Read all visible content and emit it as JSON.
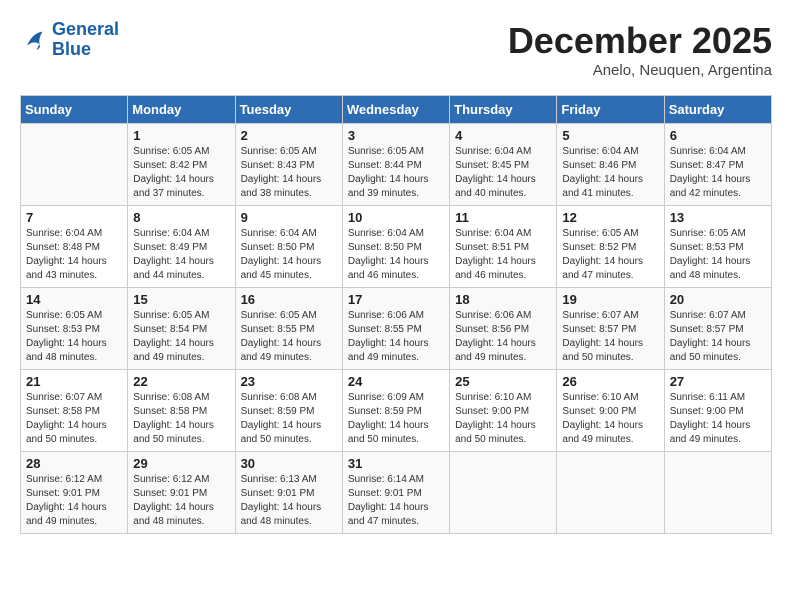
{
  "header": {
    "logo_line1": "General",
    "logo_line2": "Blue",
    "month": "December 2025",
    "location": "Anelo, Neuquen, Argentina"
  },
  "weekdays": [
    "Sunday",
    "Monday",
    "Tuesday",
    "Wednesday",
    "Thursday",
    "Friday",
    "Saturday"
  ],
  "weeks": [
    [
      {
        "day": "",
        "info": ""
      },
      {
        "day": "1",
        "info": "Sunrise: 6:05 AM\nSunset: 8:42 PM\nDaylight: 14 hours\nand 37 minutes."
      },
      {
        "day": "2",
        "info": "Sunrise: 6:05 AM\nSunset: 8:43 PM\nDaylight: 14 hours\nand 38 minutes."
      },
      {
        "day": "3",
        "info": "Sunrise: 6:05 AM\nSunset: 8:44 PM\nDaylight: 14 hours\nand 39 minutes."
      },
      {
        "day": "4",
        "info": "Sunrise: 6:04 AM\nSunset: 8:45 PM\nDaylight: 14 hours\nand 40 minutes."
      },
      {
        "day": "5",
        "info": "Sunrise: 6:04 AM\nSunset: 8:46 PM\nDaylight: 14 hours\nand 41 minutes."
      },
      {
        "day": "6",
        "info": "Sunrise: 6:04 AM\nSunset: 8:47 PM\nDaylight: 14 hours\nand 42 minutes."
      }
    ],
    [
      {
        "day": "7",
        "info": "Sunrise: 6:04 AM\nSunset: 8:48 PM\nDaylight: 14 hours\nand 43 minutes."
      },
      {
        "day": "8",
        "info": "Sunrise: 6:04 AM\nSunset: 8:49 PM\nDaylight: 14 hours\nand 44 minutes."
      },
      {
        "day": "9",
        "info": "Sunrise: 6:04 AM\nSunset: 8:50 PM\nDaylight: 14 hours\nand 45 minutes."
      },
      {
        "day": "10",
        "info": "Sunrise: 6:04 AM\nSunset: 8:50 PM\nDaylight: 14 hours\nand 46 minutes."
      },
      {
        "day": "11",
        "info": "Sunrise: 6:04 AM\nSunset: 8:51 PM\nDaylight: 14 hours\nand 46 minutes."
      },
      {
        "day": "12",
        "info": "Sunrise: 6:05 AM\nSunset: 8:52 PM\nDaylight: 14 hours\nand 47 minutes."
      },
      {
        "day": "13",
        "info": "Sunrise: 6:05 AM\nSunset: 8:53 PM\nDaylight: 14 hours\nand 48 minutes."
      }
    ],
    [
      {
        "day": "14",
        "info": "Sunrise: 6:05 AM\nSunset: 8:53 PM\nDaylight: 14 hours\nand 48 minutes."
      },
      {
        "day": "15",
        "info": "Sunrise: 6:05 AM\nSunset: 8:54 PM\nDaylight: 14 hours\nand 49 minutes."
      },
      {
        "day": "16",
        "info": "Sunrise: 6:05 AM\nSunset: 8:55 PM\nDaylight: 14 hours\nand 49 minutes."
      },
      {
        "day": "17",
        "info": "Sunrise: 6:06 AM\nSunset: 8:55 PM\nDaylight: 14 hours\nand 49 minutes."
      },
      {
        "day": "18",
        "info": "Sunrise: 6:06 AM\nSunset: 8:56 PM\nDaylight: 14 hours\nand 49 minutes."
      },
      {
        "day": "19",
        "info": "Sunrise: 6:07 AM\nSunset: 8:57 PM\nDaylight: 14 hours\nand 50 minutes."
      },
      {
        "day": "20",
        "info": "Sunrise: 6:07 AM\nSunset: 8:57 PM\nDaylight: 14 hours\nand 50 minutes."
      }
    ],
    [
      {
        "day": "21",
        "info": "Sunrise: 6:07 AM\nSunset: 8:58 PM\nDaylight: 14 hours\nand 50 minutes."
      },
      {
        "day": "22",
        "info": "Sunrise: 6:08 AM\nSunset: 8:58 PM\nDaylight: 14 hours\nand 50 minutes."
      },
      {
        "day": "23",
        "info": "Sunrise: 6:08 AM\nSunset: 8:59 PM\nDaylight: 14 hours\nand 50 minutes."
      },
      {
        "day": "24",
        "info": "Sunrise: 6:09 AM\nSunset: 8:59 PM\nDaylight: 14 hours\nand 50 minutes."
      },
      {
        "day": "25",
        "info": "Sunrise: 6:10 AM\nSunset: 9:00 PM\nDaylight: 14 hours\nand 50 minutes."
      },
      {
        "day": "26",
        "info": "Sunrise: 6:10 AM\nSunset: 9:00 PM\nDaylight: 14 hours\nand 49 minutes."
      },
      {
        "day": "27",
        "info": "Sunrise: 6:11 AM\nSunset: 9:00 PM\nDaylight: 14 hours\nand 49 minutes."
      }
    ],
    [
      {
        "day": "28",
        "info": "Sunrise: 6:12 AM\nSunset: 9:01 PM\nDaylight: 14 hours\nand 49 minutes."
      },
      {
        "day": "29",
        "info": "Sunrise: 6:12 AM\nSunset: 9:01 PM\nDaylight: 14 hours\nand 48 minutes."
      },
      {
        "day": "30",
        "info": "Sunrise: 6:13 AM\nSunset: 9:01 PM\nDaylight: 14 hours\nand 48 minutes."
      },
      {
        "day": "31",
        "info": "Sunrise: 6:14 AM\nSunset: 9:01 PM\nDaylight: 14 hours\nand 47 minutes."
      },
      {
        "day": "",
        "info": ""
      },
      {
        "day": "",
        "info": ""
      },
      {
        "day": "",
        "info": ""
      }
    ]
  ]
}
